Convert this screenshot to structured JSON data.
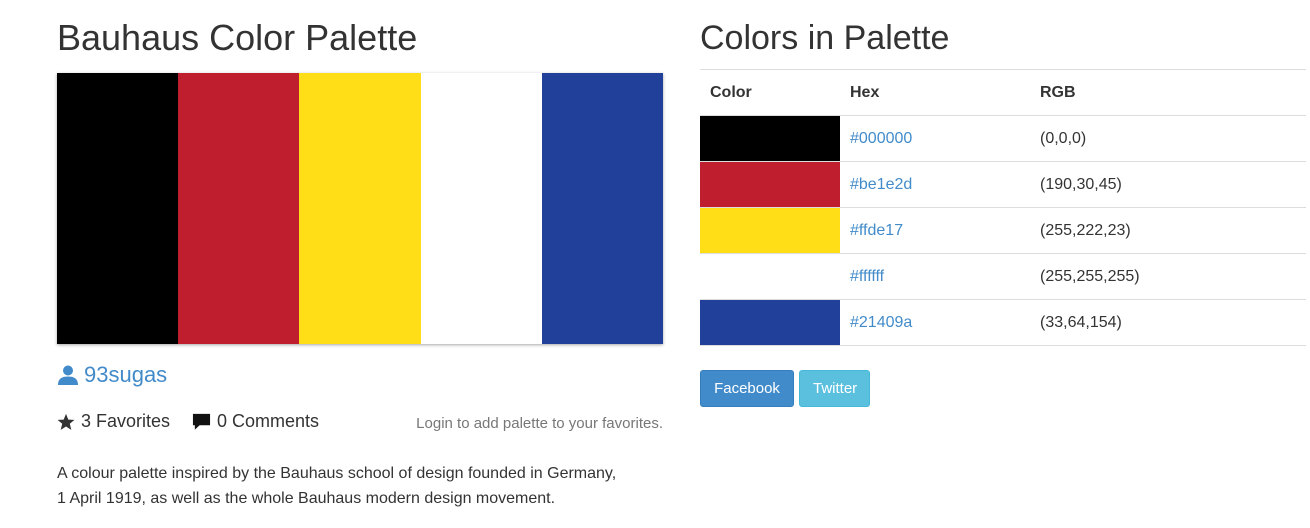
{
  "palette": {
    "title": "Bauhaus Color Palette",
    "swatches": [
      "#000000",
      "#be1e2d",
      "#ffde17",
      "#ffffff",
      "#21409a"
    ],
    "author": "93sugas",
    "favorites_count": "3",
    "favorites_label": "Favorites",
    "comments_count": "0",
    "comments_label": "Comments",
    "login_hint": "Login to add palette to your favorites.",
    "description": "A colour palette inspired by the Bauhaus school of design founded in Germany, 1 April 1919, as well as the whole Bauhaus modern design movement."
  },
  "colors_section": {
    "title": "Colors in Palette",
    "headers": {
      "color": "Color",
      "hex": "Hex",
      "rgb": "RGB"
    },
    "rows": [
      {
        "swatch": "#000000",
        "hex": "#000000",
        "rgb": "(0,0,0)"
      },
      {
        "swatch": "#be1e2d",
        "hex": "#be1e2d",
        "rgb": "(190,30,45)"
      },
      {
        "swatch": "#ffde17",
        "hex": "#ffde17",
        "rgb": "(255,222,23)"
      },
      {
        "swatch": "#ffffff",
        "hex": "#ffffff",
        "rgb": "(255,255,255)"
      },
      {
        "swatch": "#21409a",
        "hex": "#21409a",
        "rgb": "(33,64,154)"
      }
    ]
  },
  "share": {
    "facebook_label": "Facebook",
    "twitter_label": "Twitter"
  },
  "icons": {
    "author": "user-icon",
    "favorites": "star-icon",
    "comments": "comment-icon"
  },
  "theme": {
    "link_color": "#428bca",
    "facebook_color": "#428bca",
    "twitter_color": "#5bc0de"
  }
}
